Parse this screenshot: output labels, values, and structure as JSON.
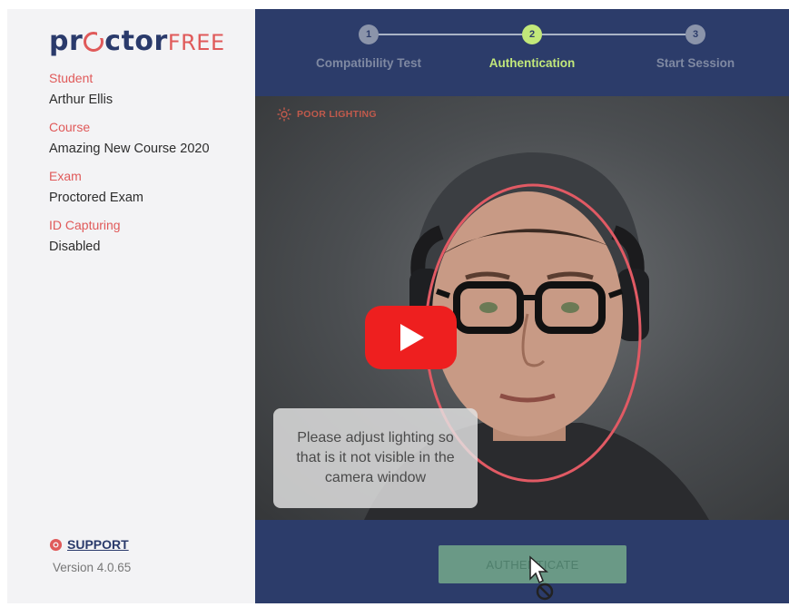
{
  "sidebar": {
    "logo": {
      "main": "pr",
      "mid": "ctor",
      "suffix": "FREE"
    },
    "fields": [
      {
        "label": "Student",
        "value": "Arthur Ellis"
      },
      {
        "label": "Course",
        "value": "Amazing New Course 2020"
      },
      {
        "label": "Exam",
        "value": "Proctored Exam"
      },
      {
        "label": "ID Capturing",
        "value": "Disabled"
      }
    ],
    "support_label": "SUPPORT",
    "version": "Version 4.0.65"
  },
  "stepper": {
    "steps": [
      {
        "number": "1",
        "label": "Compatibility Test",
        "active": false
      },
      {
        "number": "2",
        "label": "Authentication",
        "active": true
      },
      {
        "number": "3",
        "label": "Start Session",
        "active": false
      }
    ]
  },
  "camera": {
    "warning_label": "POOR LIGHTING",
    "tooltip_text": "Please adjust lighting so that is it not visible in the camera window"
  },
  "actions": {
    "authenticate_label": "AUTHENTICATE"
  },
  "colors": {
    "brand_navy": "#2c3c6a",
    "accent_red": "#e05a5a",
    "step_active": "#c2e87a",
    "button_green": "#6a9986",
    "video_play_red": "#ee1f1f"
  }
}
